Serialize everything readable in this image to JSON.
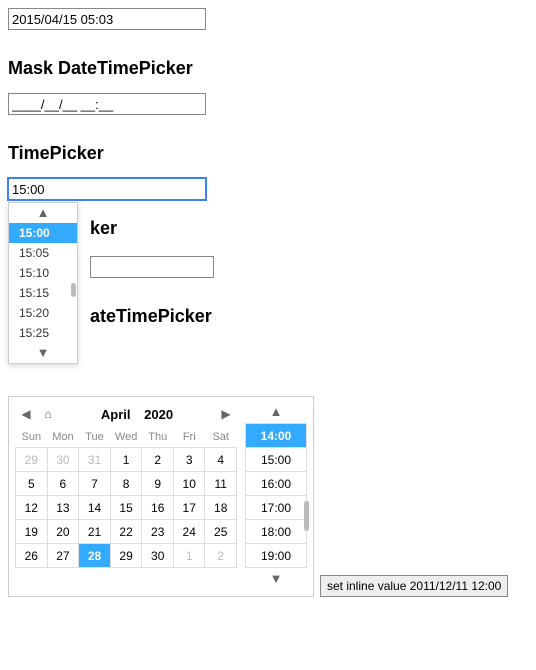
{
  "top_input": {
    "value": "2015/04/15 05:03"
  },
  "mask_section": {
    "heading": "Mask DateTimePicker",
    "value": "____/__/__ __:__"
  },
  "timepicker_section": {
    "heading": "TimePicker",
    "value": "15:00",
    "popup": {
      "selected": "15:00",
      "items": [
        "15:00",
        "15:05",
        "15:10",
        "15:15",
        "15:20",
        "15:25"
      ]
    }
  },
  "hidden_section1": {
    "heading_fragment": "ker"
  },
  "hidden_input": {
    "value": ""
  },
  "hidden_section2": {
    "heading_fragment": "ateTimePicker"
  },
  "inline": {
    "header": {
      "month": "April",
      "year": "2020"
    },
    "dow": [
      "Sun",
      "Mon",
      "Tue",
      "Wed",
      "Thu",
      "Fri",
      "Sat"
    ],
    "weeks": [
      [
        {
          "d": "29",
          "o": true
        },
        {
          "d": "30",
          "o": true
        },
        {
          "d": "31",
          "o": true
        },
        {
          "d": "1"
        },
        {
          "d": "2"
        },
        {
          "d": "3"
        },
        {
          "d": "4"
        }
      ],
      [
        {
          "d": "5"
        },
        {
          "d": "6"
        },
        {
          "d": "7"
        },
        {
          "d": "8"
        },
        {
          "d": "9"
        },
        {
          "d": "10"
        },
        {
          "d": "11"
        }
      ],
      [
        {
          "d": "12"
        },
        {
          "d": "13"
        },
        {
          "d": "14"
        },
        {
          "d": "15"
        },
        {
          "d": "16"
        },
        {
          "d": "17"
        },
        {
          "d": "18"
        }
      ],
      [
        {
          "d": "19"
        },
        {
          "d": "20"
        },
        {
          "d": "21"
        },
        {
          "d": "22"
        },
        {
          "d": "23"
        },
        {
          "d": "24"
        },
        {
          "d": "25"
        }
      ],
      [
        {
          "d": "26"
        },
        {
          "d": "27"
        },
        {
          "d": "28",
          "sel": true
        },
        {
          "d": "29"
        },
        {
          "d": "30"
        },
        {
          "d": "1",
          "o": true
        },
        {
          "d": "2",
          "o": true
        }
      ]
    ],
    "times": {
      "selected": "14:00",
      "items": [
        "14:00",
        "15:00",
        "16:00",
        "17:00",
        "18:00",
        "19:00"
      ]
    },
    "button_label": "set inline value 2011/12/11 12:00"
  },
  "glyphs": {
    "up": "▲",
    "down": "▼",
    "left": "◀",
    "right": "▶",
    "home": "⌂"
  }
}
